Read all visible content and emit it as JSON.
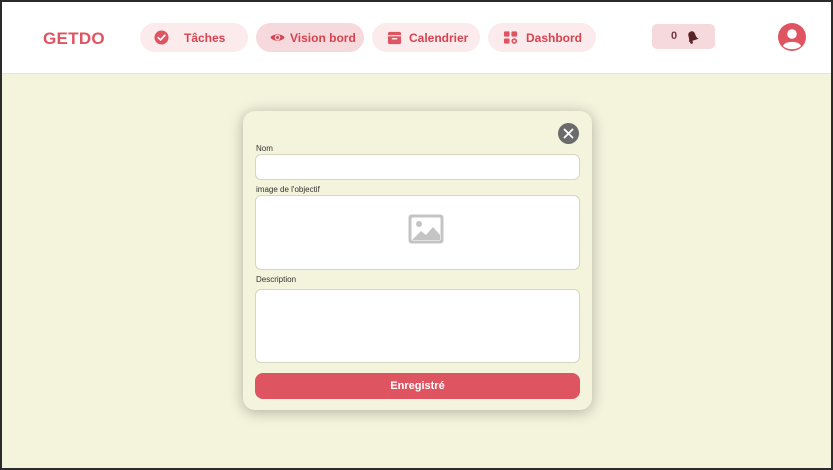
{
  "app": {
    "logo": "GETDO"
  },
  "nav": {
    "items": [
      {
        "label": "Tâches",
        "icon": "check-circle-icon"
      },
      {
        "label": "Vision bord",
        "icon": "eye-icon",
        "active": true
      },
      {
        "label": "Calendrier",
        "icon": "calendar-icon"
      },
      {
        "label": "Dashbord",
        "icon": "dashboard-icon"
      }
    ]
  },
  "notifications": {
    "count": "0",
    "icon": "bell-icon"
  },
  "user": {
    "icon": "user-avatar-icon"
  },
  "modal": {
    "name_label": "Nom",
    "name_value": "",
    "image_label": "image de l'objectif",
    "image_icon": "image-placeholder-icon",
    "description_label": "Description",
    "description_value": "",
    "submit_label": "Enregistré",
    "close_icon": "close-icon"
  },
  "colors": {
    "accent": "#df5461",
    "background": "#f4f3dc",
    "pill": "#fcebec",
    "pill_active": "#f6d9dc"
  }
}
